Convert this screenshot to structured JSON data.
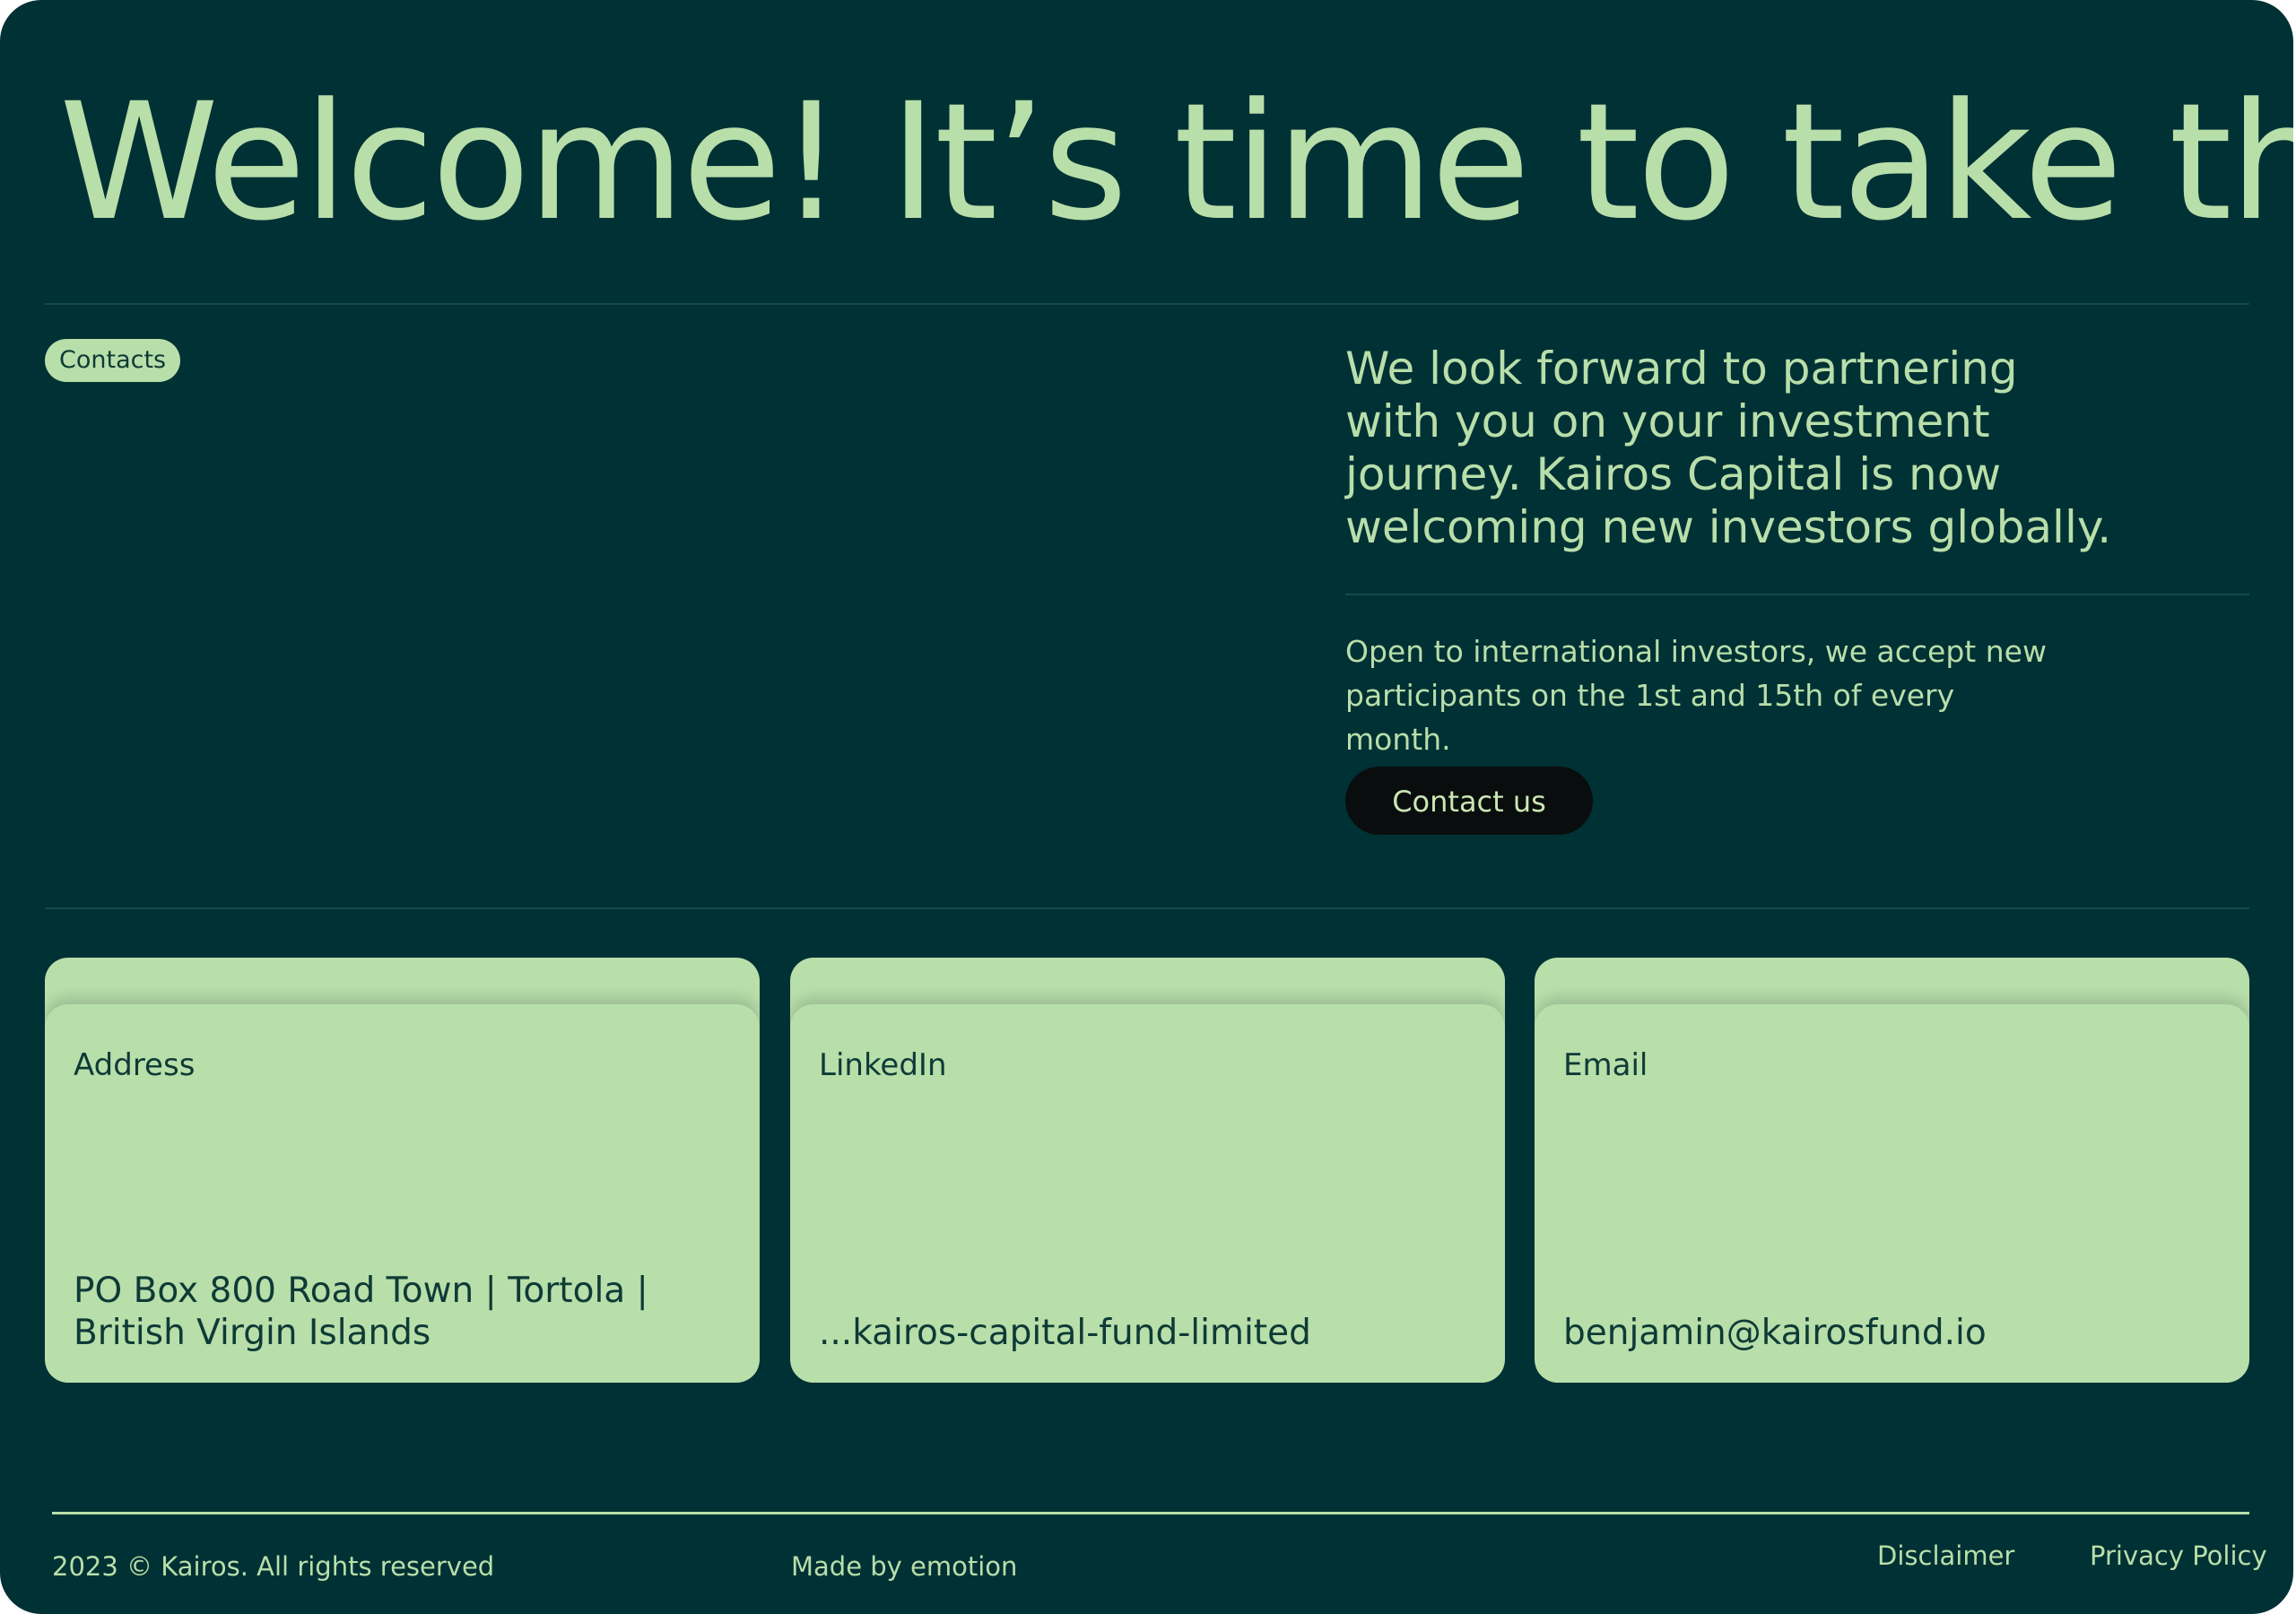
{
  "hero": {
    "title": "Welcome! It’s time to take the lead"
  },
  "contacts_tag": "Contacts",
  "intro": {
    "lead": "We look forward to partnering with you on your investment journey. Kairos Capital is now welcoming new investors globally.",
    "sub": "Open to international investors, we accept new participants on the 1st and 15th of every month.",
    "cta_label": "Contact us"
  },
  "cards": [
    {
      "title": "Address",
      "value": "PO Box 800 Road Town | Tortola | British Virgin Islands"
    },
    {
      "title": "LinkedIn",
      "value": "...kairos-capital-fund-limited"
    },
    {
      "title": "Email",
      "value": "benjamin@kairosfund.io"
    }
  ],
  "footer": {
    "copyright": "2023 © Kairos. All rights reserved",
    "made_by": "Made by emotion",
    "links": [
      "Disclaimer",
      "Privacy Policy"
    ]
  },
  "colors": {
    "background": "#003134",
    "accent": "#b8deaa",
    "button": "#0a0d0d"
  }
}
